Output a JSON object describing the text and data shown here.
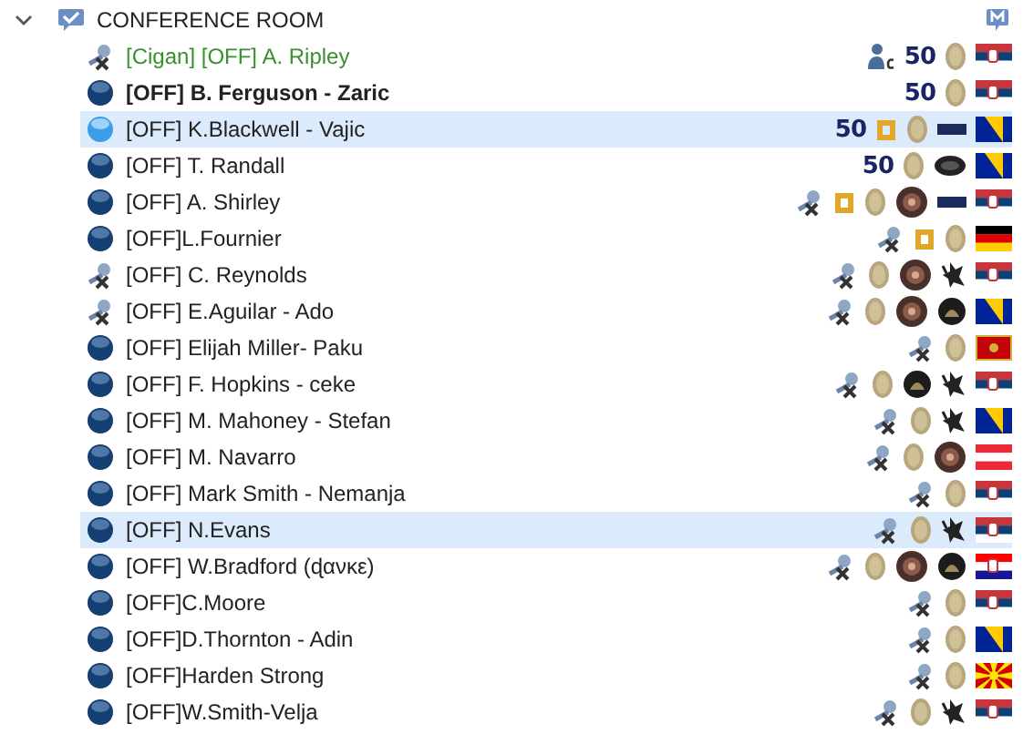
{
  "channel": {
    "name": "CONFERENCE ROOM",
    "expanded": true
  },
  "clients": [
    {
      "name": "[Cigan] [OFF] A. Ripley",
      "kind": "muted",
      "selected": false,
      "bold": false,
      "color": "#3a8f2e",
      "badges": [
        {
          "kind": "person"
        },
        {
          "kind": "level",
          "text": "50"
        },
        {
          "kind": "coin"
        },
        {
          "kind": "flag-rs"
        }
      ]
    },
    {
      "name": "[OFF] B. Ferguson - Zaric",
      "kind": "idle",
      "selected": false,
      "bold": true,
      "badges": [
        {
          "kind": "level",
          "text": "50"
        },
        {
          "kind": "coin"
        },
        {
          "kind": "flag-rs"
        }
      ]
    },
    {
      "name": "[OFF] K.Blackwell - Vajic",
      "kind": "talking",
      "selected": true,
      "bold": false,
      "badges": [
        {
          "kind": "level",
          "text": "50"
        },
        {
          "kind": "d"
        },
        {
          "kind": "coin"
        },
        {
          "kind": "bar"
        },
        {
          "kind": "flag-ba"
        }
      ]
    },
    {
      "name": "[OFF] T. Randall",
      "kind": "idle",
      "selected": false,
      "bold": false,
      "badges": [
        {
          "kind": "level",
          "text": "50"
        },
        {
          "kind": "coin"
        },
        {
          "kind": "oval"
        },
        {
          "kind": "flag-ba"
        }
      ]
    },
    {
      "name": "[OFF] A. Shirley",
      "kind": "idle",
      "selected": false,
      "bold": false,
      "badges": [
        {
          "kind": "mute"
        },
        {
          "kind": "d"
        },
        {
          "kind": "coin"
        },
        {
          "kind": "medal"
        },
        {
          "kind": "bar"
        },
        {
          "kind": "flag-rs"
        }
      ]
    },
    {
      "name": "[OFF]L.Fournier",
      "kind": "idle",
      "selected": false,
      "bold": false,
      "badges": [
        {
          "kind": "mute"
        },
        {
          "kind": "d"
        },
        {
          "kind": "coin"
        },
        {
          "kind": "flag-de"
        }
      ]
    },
    {
      "name": "[OFF] C. Reynolds",
      "kind": "muted",
      "selected": false,
      "bold": false,
      "badges": [
        {
          "kind": "mute"
        },
        {
          "kind": "coin"
        },
        {
          "kind": "medal"
        },
        {
          "kind": "wolf"
        },
        {
          "kind": "flag-rs"
        }
      ]
    },
    {
      "name": "[OFF] E.Aguilar - Ado",
      "kind": "muted",
      "selected": false,
      "bold": false,
      "badges": [
        {
          "kind": "mute"
        },
        {
          "kind": "coin"
        },
        {
          "kind": "medal"
        },
        {
          "kind": "emblem"
        },
        {
          "kind": "flag-ba"
        }
      ]
    },
    {
      "name": "[OFF] Elijah Miller- Paku",
      "kind": "idle",
      "selected": false,
      "bold": false,
      "badges": [
        {
          "kind": "mute"
        },
        {
          "kind": "coin"
        },
        {
          "kind": "flag-me"
        }
      ]
    },
    {
      "name": "[OFF] F. Hopkins - ceke",
      "kind": "idle",
      "selected": false,
      "bold": false,
      "badges": [
        {
          "kind": "mute"
        },
        {
          "kind": "coin"
        },
        {
          "kind": "emblem"
        },
        {
          "kind": "wolf"
        },
        {
          "kind": "flag-rs"
        }
      ]
    },
    {
      "name": "[OFF] M. Mahoney - Stefan",
      "kind": "idle",
      "selected": false,
      "bold": false,
      "badges": [
        {
          "kind": "mute"
        },
        {
          "kind": "coin"
        },
        {
          "kind": "wolf"
        },
        {
          "kind": "flag-ba"
        }
      ]
    },
    {
      "name": "[OFF] M. Navarro",
      "kind": "idle",
      "selected": false,
      "bold": false,
      "badges": [
        {
          "kind": "mute"
        },
        {
          "kind": "coin"
        },
        {
          "kind": "medal"
        },
        {
          "kind": "flag-at"
        }
      ]
    },
    {
      "name": "[OFF] Mark Smith - Nemanja",
      "kind": "idle",
      "selected": false,
      "bold": false,
      "badges": [
        {
          "kind": "mute"
        },
        {
          "kind": "coin"
        },
        {
          "kind": "flag-rs"
        }
      ]
    },
    {
      "name": "[OFF] N.Evans",
      "kind": "idle",
      "selected": true,
      "bold": false,
      "badges": [
        {
          "kind": "mute"
        },
        {
          "kind": "coin"
        },
        {
          "kind": "wolf"
        },
        {
          "kind": "flag-rs"
        }
      ]
    },
    {
      "name": "[OFF] W.Bradford (ɖανκε)",
      "kind": "idle",
      "selected": false,
      "bold": false,
      "badges": [
        {
          "kind": "mute"
        },
        {
          "kind": "coin"
        },
        {
          "kind": "medal"
        },
        {
          "kind": "emblem"
        },
        {
          "kind": "flag-hr"
        }
      ]
    },
    {
      "name": "[OFF]C.Moore",
      "kind": "idle",
      "selected": false,
      "bold": false,
      "badges": [
        {
          "kind": "mute"
        },
        {
          "kind": "coin"
        },
        {
          "kind": "flag-rs"
        }
      ]
    },
    {
      "name": "[OFF]D.Thornton - Adin",
      "kind": "idle",
      "selected": false,
      "bold": false,
      "badges": [
        {
          "kind": "mute"
        },
        {
          "kind": "coin"
        },
        {
          "kind": "flag-ba"
        }
      ]
    },
    {
      "name": "[OFF]Harden Strong",
      "kind": "idle",
      "selected": false,
      "bold": false,
      "badges": [
        {
          "kind": "mute"
        },
        {
          "kind": "coin"
        },
        {
          "kind": "flag-mk"
        }
      ]
    },
    {
      "name": "[OFF]W.Smith-Velja",
      "kind": "idle",
      "selected": false,
      "bold": false,
      "badges": [
        {
          "kind": "mute"
        },
        {
          "kind": "coin"
        },
        {
          "kind": "wolf"
        },
        {
          "kind": "flag-rs"
        }
      ]
    }
  ]
}
